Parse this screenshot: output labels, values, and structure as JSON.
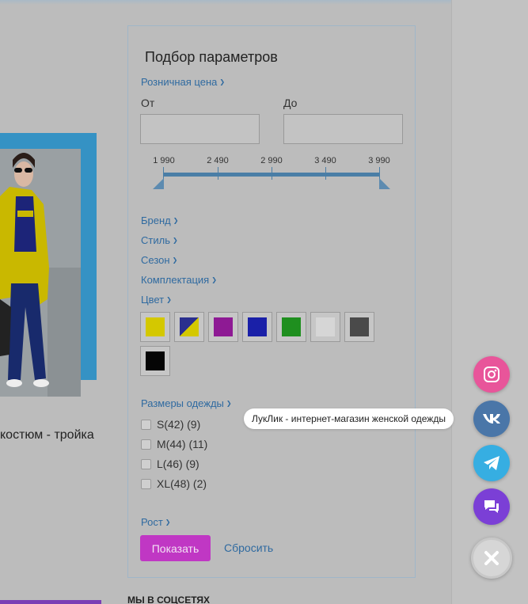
{
  "product": {
    "title": "костюм - тройка"
  },
  "filter": {
    "title": "Подбор параметров",
    "price": {
      "label": "Розничная цена",
      "from_label": "От",
      "to_label": "До",
      "from_value": "",
      "to_value": "",
      "ticks": [
        "1 990",
        "2 490",
        "2 990",
        "3 490",
        "3 990"
      ]
    },
    "sections": {
      "brand": "Бренд",
      "style": "Стиль",
      "season": "Сезон",
      "set": "Комплектация",
      "color": "Цвет",
      "sizes": "Размеры одежды",
      "height": "Рост"
    },
    "colors": [
      {
        "name": "yellow",
        "hex": "#d4c800"
      },
      {
        "name": "navy-yellow",
        "hex": "#2a2f8e"
      },
      {
        "name": "purple",
        "hex": "#8e1a94"
      },
      {
        "name": "blue",
        "hex": "#1a20a8"
      },
      {
        "name": "green",
        "hex": "#1f8f1f"
      },
      {
        "name": "white",
        "hex": "#d6d6d6"
      },
      {
        "name": "gray",
        "hex": "#4a4a4a"
      },
      {
        "name": "black",
        "hex": "#050505"
      }
    ],
    "size_options": [
      {
        "label": "S(42) (9)",
        "checked": false
      },
      {
        "label": "M(44) (11)",
        "checked": false
      },
      {
        "label": "L(46) (9)",
        "checked": false
      },
      {
        "label": "XL(48) (2)",
        "checked": false
      }
    ],
    "show_button": "Показать",
    "reset_link": "Сбросить"
  },
  "social_heading": "МЫ В СОЦСЕТЯХ",
  "widgets": {
    "tooltip": "ЛукЛик - интернет-магазин женской одежды",
    "instagram_color": "#e8559a",
    "vk_color": "#4a76a8",
    "telegram_color": "#36aee2",
    "chat_color": "#7b3fd6",
    "close_color": "#d6d6d6"
  }
}
